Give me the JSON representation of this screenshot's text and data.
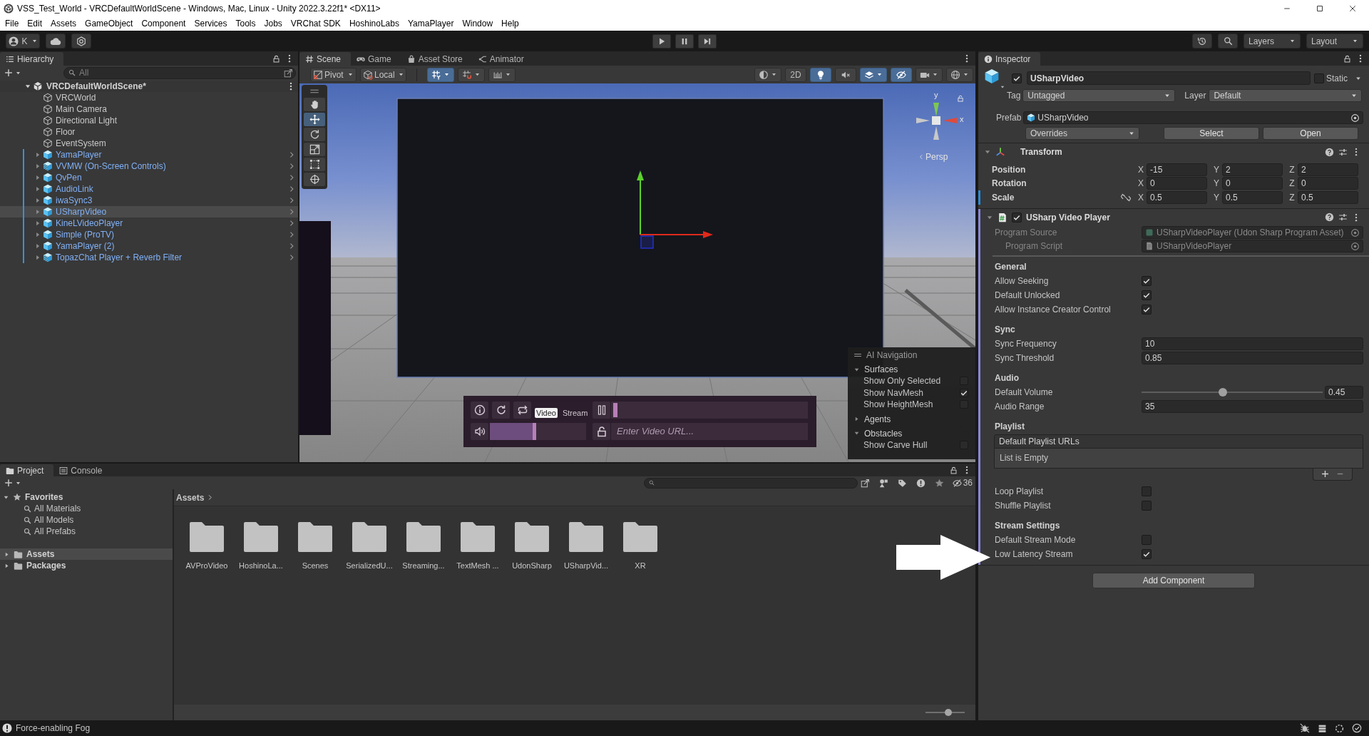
{
  "window": {
    "title": "VSS_Test_World - VRCDefaultWorldScene - Windows, Mac, Linux - Unity 2022.3.22f1* <DX11>"
  },
  "menu_bar": [
    "File",
    "Edit",
    "Assets",
    "GameObject",
    "Component",
    "Services",
    "Tools",
    "Jobs",
    "VRChat SDK",
    "HoshinoLabs",
    "YamaPlayer",
    "Window",
    "Help"
  ],
  "main_toolbar": {
    "account": "K",
    "layers": "Layers",
    "layout": "Layout"
  },
  "hierarchy": {
    "title": "Hierarchy",
    "search": {
      "placeholder": "All"
    },
    "scene": {
      "name": "VRCDefaultWorldScene*",
      "expanded": true,
      "children": [
        {
          "name": "VRCWorld",
          "kind": "object",
          "selected": false
        },
        {
          "name": "Main Camera",
          "kind": "object",
          "selected": false
        },
        {
          "name": "Directional Light",
          "kind": "object",
          "selected": false
        },
        {
          "name": "Floor",
          "kind": "object",
          "selected": false
        },
        {
          "name": "EventSystem",
          "kind": "object",
          "selected": false
        },
        {
          "name": "YamaPlayer",
          "kind": "prefab",
          "expanded": false,
          "selected": false
        },
        {
          "name": "VVMW (On-Screen Controls)",
          "kind": "variant",
          "expanded": false,
          "selected": false
        },
        {
          "name": "QvPen",
          "kind": "prefab",
          "expanded": false,
          "selected": false
        },
        {
          "name": "AudioLink",
          "kind": "prefab",
          "expanded": false,
          "selected": false
        },
        {
          "name": "iwaSync3",
          "kind": "prefab",
          "expanded": false,
          "selected": false
        },
        {
          "name": "USharpVideo",
          "kind": "prefab",
          "expanded": false,
          "selected": true
        },
        {
          "name": "KineLVideoPlayer",
          "kind": "prefab",
          "expanded": false,
          "selected": false
        },
        {
          "name": "Simple (ProTV)",
          "kind": "prefab",
          "expanded": false,
          "selected": false
        },
        {
          "name": "YamaPlayer (2)",
          "kind": "prefab",
          "expanded": false,
          "selected": false
        },
        {
          "name": "TopazChat Player + Reverb Filter",
          "kind": "variant",
          "expanded": false,
          "selected": false
        }
      ]
    }
  },
  "scene_panel": {
    "tabs": [
      {
        "label": "Scene",
        "kind": "scene",
        "selected": true
      },
      {
        "label": "Game",
        "kind": "game",
        "selected": false
      },
      {
        "label": "Asset Store",
        "kind": "store",
        "selected": false
      },
      {
        "label": "Animator",
        "kind": "animator",
        "selected": false
      }
    ],
    "toolbar": {
      "pivot": "Pivot",
      "space": "Local",
      "snapping": [
        {
          "kind": "grid",
          "on": true
        },
        {
          "kind": "snap",
          "on": false
        },
        {
          "kind": "increment",
          "on": false
        }
      ],
      "view_options": [
        {
          "kind": "shading",
          "on": false
        },
        {
          "kind": "planar",
          "label": "2D",
          "on": false
        },
        {
          "kind": "lighting",
          "on": true
        },
        {
          "kind": "audio",
          "on": false
        },
        {
          "kind": "effects",
          "on": true
        },
        {
          "kind": "visibility",
          "on": true
        },
        {
          "kind": "camera",
          "on": false
        },
        {
          "kind": "gizmos",
          "on": false
        }
      ]
    },
    "tools": [
      {
        "kind": "hand",
        "selected": false
      },
      {
        "kind": "move",
        "selected": true
      },
      {
        "kind": "rotate",
        "selected": false
      },
      {
        "kind": "scale",
        "selected": false
      },
      {
        "kind": "rect",
        "selected": false
      },
      {
        "kind": "transform",
        "selected": false
      }
    ],
    "orientation": {
      "axes": [
        "y",
        "x"
      ],
      "projection": "Persp"
    },
    "video_player": {
      "modes": [
        {
          "label": "Video",
          "selected": true
        },
        {
          "label": "Stream",
          "selected": false
        }
      ],
      "progress": {
        "level": 0.01
      },
      "volume": {
        "level": 0.48
      },
      "url": {
        "placeholder": "Enter Video URL..."
      }
    },
    "ai_navigation": {
      "title": "AI Navigation",
      "sections": [
        {
          "label": "Surfaces",
          "expanded": true,
          "options": [
            {
              "label": "Show Only Selected",
              "checked": false
            },
            {
              "label": "Show NavMesh",
              "checked": true
            },
            {
              "label": "Show HeightMesh",
              "checked": false
            }
          ]
        },
        {
          "label": "Agents",
          "expanded": false
        },
        {
          "label": "Obstacles",
          "expanded": true,
          "options": [
            {
              "label": "Show Carve Hull",
              "checked": false
            }
          ]
        }
      ]
    }
  },
  "inspector": {
    "title": "Inspector",
    "object": {
      "active": true,
      "name": "USharpVideo",
      "static": {
        "label": "Static",
        "checked": false
      },
      "tag": {
        "label": "Tag",
        "value": "Untagged"
      },
      "layer": {
        "label": "Layer",
        "value": "Default"
      },
      "prefab": {
        "label": "Prefab",
        "value": "USharpVideo",
        "overrides": "Overrides",
        "buttons": [
          "Select",
          "Open"
        ]
      }
    },
    "components": [
      {
        "kind": "transform",
        "title": "Transform",
        "expanded": true,
        "added": false,
        "rows": [
          {
            "label": "Position",
            "overridden": false,
            "values": [
              {
                "axis": "X",
                "value": "-15"
              },
              {
                "axis": "Y",
                "value": "2"
              },
              {
                "axis": "Z",
                "value": "2"
              }
            ]
          },
          {
            "label": "Rotation",
            "overridden": false,
            "values": [
              {
                "axis": "X",
                "value": "0"
              },
              {
                "axis": "Y",
                "value": "0"
              },
              {
                "axis": "Z",
                "value": "0"
              }
            ]
          },
          {
            "label": "Scale",
            "overridden": true,
            "proportions_linked": false,
            "values": [
              {
                "axis": "X",
                "value": "0.5"
              },
              {
                "axis": "Y",
                "value": "0.5"
              },
              {
                "axis": "Z",
                "value": "0.5"
              }
            ]
          }
        ]
      },
      {
        "kind": "script",
        "title": "USharp Video Player",
        "enabled": true,
        "expanded": true,
        "added": true,
        "references": [
          {
            "label": "Program Source",
            "value": "USharpVideoPlayer (Udon Sharp Program Asset)",
            "disabled": true
          },
          {
            "label": "Program Script",
            "value": "USharpVideoPlayer",
            "disabled": true
          }
        ],
        "groups": [
          {
            "title": "General",
            "fields": [
              {
                "kind": "toggle",
                "label": "Allow Seeking",
                "checked": true
              },
              {
                "kind": "toggle",
                "label": "Default Unlocked",
                "checked": true
              },
              {
                "kind": "toggle",
                "label": "Allow Instance Creator Control",
                "checked": true
              }
            ]
          },
          {
            "title": "Sync",
            "fields": [
              {
                "kind": "number",
                "label": "Sync Frequency",
                "value": "10"
              },
              {
                "kind": "number",
                "label": "Sync Threshold",
                "value": "0.85"
              }
            ]
          },
          {
            "title": "Audio",
            "fields": [
              {
                "kind": "slider",
                "label": "Default Volume",
                "level": 0.45,
                "value": "0.45"
              },
              {
                "kind": "number",
                "label": "Audio Range",
                "value": "35"
              }
            ]
          },
          {
            "title": "Playlist",
            "fields": [
              {
                "kind": "list",
                "label": "Default Playlist URLs",
                "empty_text": "List is Empty"
              },
              {
                "kind": "toggle",
                "label": "Loop Playlist",
                "checked": false
              },
              {
                "kind": "toggle",
                "label": "Shuffle Playlist",
                "checked": false
              }
            ]
          },
          {
            "title": "Stream Settings",
            "fields": [
              {
                "kind": "toggle",
                "label": "Default Stream Mode",
                "checked": false
              },
              {
                "kind": "toggle",
                "label": "Low Latency Stream",
                "checked": true
              }
            ]
          }
        ]
      }
    ],
    "add_component": "Add Component"
  },
  "project_panel": {
    "tabs": [
      {
        "label": "Project",
        "kind": "project",
        "selected": true
      },
      {
        "label": "Console",
        "kind": "console",
        "selected": false
      }
    ],
    "hidden_count": "36",
    "favorites": {
      "label": "Favorites",
      "expanded": true,
      "items": [
        "All Materials",
        "All Models",
        "All Prefabs"
      ]
    },
    "roots": [
      {
        "label": "Assets",
        "expanded": false,
        "selected": true
      },
      {
        "label": "Packages",
        "expanded": false,
        "selected": false
      }
    ],
    "breadcrumb": [
      "Assets"
    ],
    "folders": [
      "AVProVideo",
      "HoshinoLa...",
      "Scenes",
      "SerializedU...",
      "Streaming...",
      "TextMesh ...",
      "UdonSharp",
      "USharpVid...",
      "XR"
    ],
    "zoom_slider": {
      "level": 0.58
    }
  },
  "status_bar": {
    "message": "Force-enabling Fog"
  }
}
